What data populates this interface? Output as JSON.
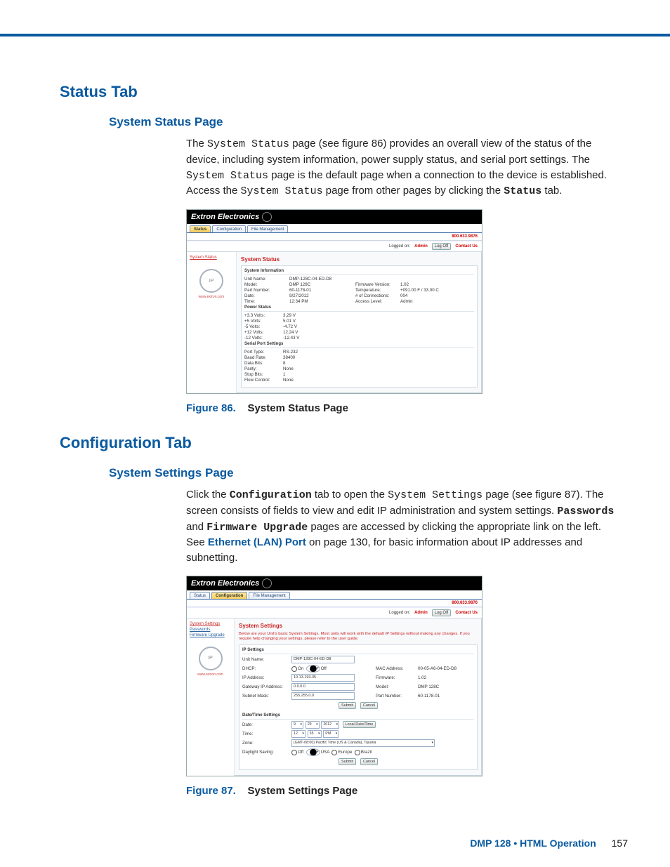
{
  "headings": {
    "status_tab": "Status Tab",
    "system_status_page": "System Status Page",
    "configuration_tab": "Configuration Tab",
    "system_settings_page": "System Settings Page"
  },
  "paragraphs": {
    "p1_a": "The ",
    "p1_code1": "System Status",
    "p1_b": " page (see figure 86) provides an overall view of the status of the device, including system information, power supply status, and serial port settings. The ",
    "p1_code2": "System Status",
    "p1_c": " page is the default page when a connection to the device is established. Access the ",
    "p1_code3": "System Status",
    "p1_d": " page from other pages by clicking the ",
    "p1_bold": "Status",
    "p1_e": " tab.",
    "p2_a": "Click the ",
    "p2_bold1": "Configuration",
    "p2_b": " tab to open the ",
    "p2_code1": "System Settings",
    "p2_c": " page (see figure 87). The screen consists of fields to view and edit IP administration and system settings. ",
    "p2_bold2": "Passwords",
    "p2_and": " and ",
    "p2_bold3": "Firmware Upgrade",
    "p2_d": " pages are accessed by clicking the appropriate link on the left. See ",
    "p2_link": "Ethernet (LAN) Port",
    "p2_e": " on page 130, for basic information about IP addresses and subnetting."
  },
  "captions": {
    "fig86_num": "Figure 86.",
    "fig86_title": "System Status Page",
    "fig87_num": "Figure 87.",
    "fig87_title": "System Settings Page"
  },
  "footer": {
    "product": "DMP 128",
    "bullet": " • ",
    "section": "HTML Operation",
    "page": "157"
  },
  "shot_common": {
    "brand": "Extron Electronics",
    "tab_status": "Status",
    "tab_configuration": "Configuration",
    "tab_file_mgmt": "File Management",
    "logged_on": "Logged on:",
    "logged_role": "Admin",
    "log_off": "Log Off",
    "contact": "Contact Us",
    "phone": "800.633.9876",
    "side_url": "www.extron.com"
  },
  "shot86": {
    "side_nav": {
      "system_status": "System Status"
    },
    "title": "System Status",
    "sections": {
      "sys_info": "System Information",
      "power": "Power Status",
      "serial": "Serial Port Settings"
    },
    "sys_info": {
      "unit_name_k": "Unit Name:",
      "unit_name_v": "DMP-128C-04-ED-D8",
      "model_k": "Model:",
      "model_v": "DMP 128C",
      "part_k": "Part Number:",
      "part_v": "60-1178-01",
      "date_k": "Date:",
      "date_v": "9/27/2012",
      "time_k": "Time:",
      "time_v": "12:34 PM",
      "fw_k": "Firmware Version:",
      "fw_v": "1.02",
      "temp_k": "Temperature:",
      "temp_v": "+091.00 F / 33.00 C",
      "conn_k": "# of Connections:",
      "conn_v": "004",
      "access_k": "Access Level:",
      "access_v": "Admin"
    },
    "power": {
      "p33_k": "+3.3 Volts:",
      "p33_v": "3.29 V",
      "p5_k": "+5 Volts:",
      "p5_v": "5.01 V",
      "m5_k": "-5 Volts:",
      "m5_v": "-4.72 V",
      "p12_k": "+12 Volts:",
      "p12_v": "12.24 V",
      "m12_k": "-12 Volts:",
      "m12_v": "-12.43 V"
    },
    "serial": {
      "ptype_k": "Port Type:",
      "ptype_v": "RS-232",
      "baud_k": "Baud Rate:",
      "baud_v": "38400",
      "dbits_k": "Data Bits:",
      "dbits_v": "8",
      "parity_k": "Parity:",
      "parity_v": "None",
      "sbits_k": "Stop Bits:",
      "sbits_v": "1",
      "flow_k": "Flow Control:",
      "flow_v": "None"
    }
  },
  "shot87": {
    "side_nav": {
      "system_settings": "System Settings",
      "passwords": "Passwords",
      "firmware_upgrade": "Firmware Upgrade"
    },
    "title": "System Settings",
    "note": "Below are your Unit's basic System Settings. Most units will work with the default IP Settings without making any changes. If you require help changing your settings, please refer to the user guide.",
    "sections": {
      "ip": "IP Settings",
      "dt": "Date/Time Settings"
    },
    "ip": {
      "unit_k": "Unit Name:",
      "unit_v": "DMP-128C-04-ED-D8",
      "dhcp_k": "DHCP:",
      "dhcp_on": "On",
      "dhcp_off": "Off",
      "ipaddr_k": "IP Address:",
      "ipaddr_v": "10.13.193.35",
      "gw_k": "Gateway IP Address:",
      "gw_v": "0.0.0.0",
      "sn_k": "Subnet Mask:",
      "sn_v": "255.255.0.0",
      "mac_k": "MAC Address:",
      "mac_v": "00-05-A6-04-ED-D8",
      "fw_k": "Firmware:",
      "fw_v": "1.02",
      "model_k": "Model:",
      "model_v": "DMP 128C",
      "part_k": "Part Number:",
      "part_v": "60-1178-01",
      "submit": "Submit",
      "cancel": "Cancel"
    },
    "dt": {
      "date_k": "Date:",
      "date_m": "9",
      "date_d": "29",
      "date_y": "2012",
      "local_btn": "Local Date/Time",
      "time_k": "Time:",
      "time_h": "12",
      "time_m": "35",
      "time_ampm": "PM",
      "zone_k": "Zone:",
      "zone_v": "(GMT-08:00) Pacific Time (US & Canada), Tijuana",
      "dst_k": "Daylight Saving:",
      "dst_off": "Off",
      "dst_usa": "USA",
      "dst_eu": "Europe",
      "dst_br": "Brazil",
      "submit": "Submit",
      "cancel": "Cancel"
    }
  }
}
